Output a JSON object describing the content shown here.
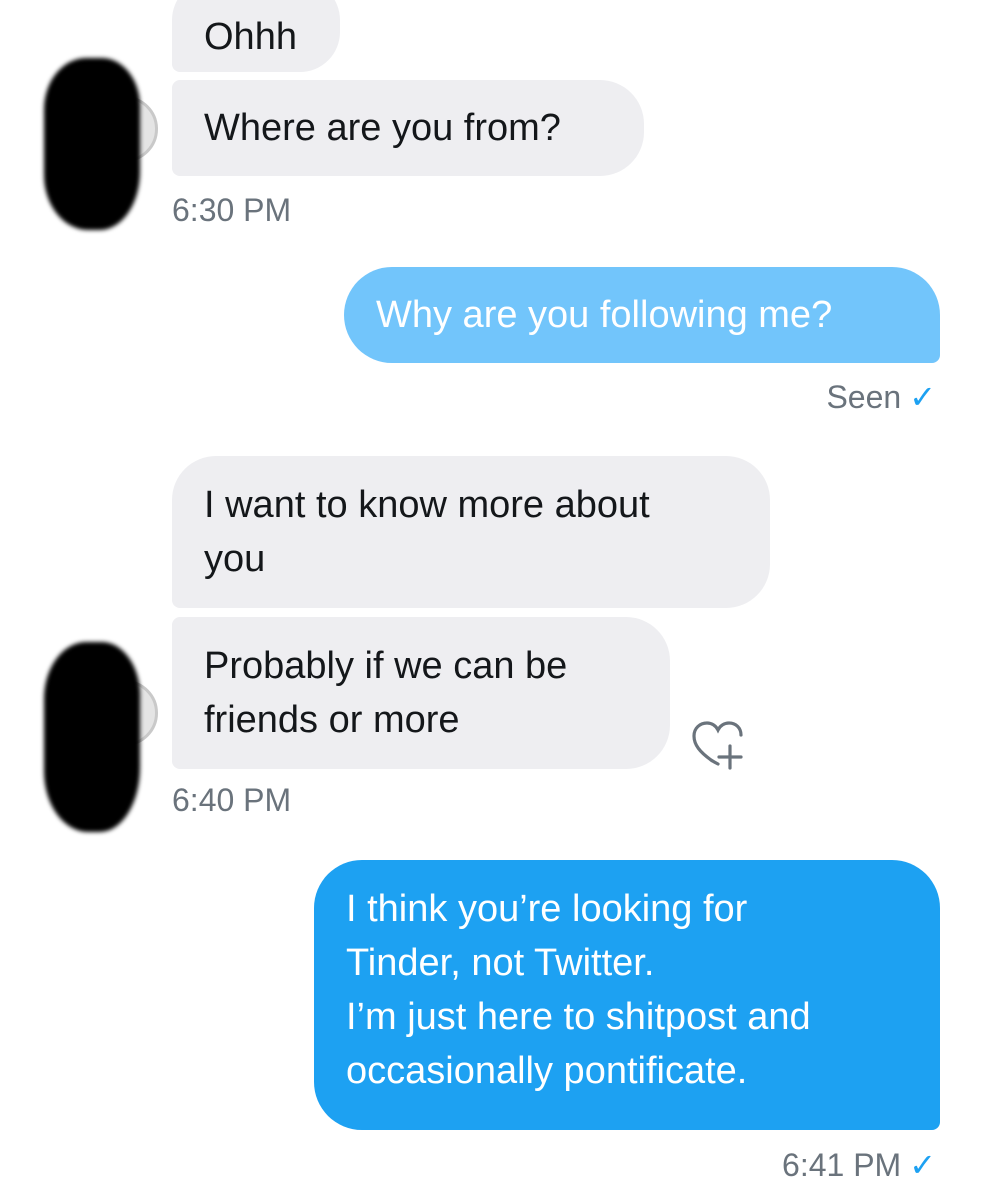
{
  "messages": {
    "m1": "Ohhh",
    "m2": "Where are you from?",
    "t1": "6:30 PM",
    "m3": "Why are you following me?",
    "seen": "Seen",
    "m4_line1": "I want to know more about",
    "m4_line2": "you",
    "m5_line1": "Probably if we can be",
    "m5_line2": "friends or more",
    "t2": "6:40 PM",
    "m6_line1": "I think you’re looking for",
    "m6_line2": "Tinder, not Twitter.",
    "m6_line3": "I’m just here to shitpost and",
    "m6_line4": "occasionally pontificate.",
    "t3": "6:41 PM"
  },
  "icons": {
    "checkmark": "✓",
    "like": "heart-plus-icon"
  },
  "colors": {
    "incoming_bubble": "#eeeef1",
    "outgoing_bubble": "#1da1f2",
    "outgoing_bubble_faded": "#72c5fb",
    "meta_text": "#6a737c"
  }
}
